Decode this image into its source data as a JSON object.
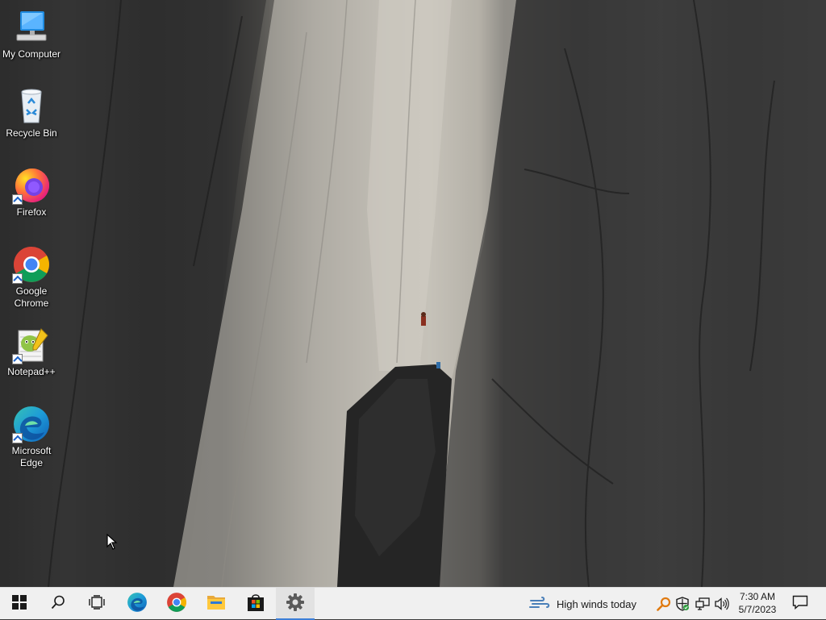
{
  "desktop": {
    "icons": [
      {
        "label": "My Computer",
        "icon": "computer-icon",
        "shortcut": false
      },
      {
        "label": "Recycle Bin",
        "icon": "recycle-bin-icon",
        "shortcut": false
      },
      {
        "label": "Firefox",
        "icon": "firefox-icon",
        "shortcut": true
      },
      {
        "label": "Google Chrome",
        "icon": "chrome-icon",
        "shortcut": true
      },
      {
        "label": "Notepad++",
        "icon": "notepadpp-icon",
        "shortcut": true
      },
      {
        "label": "Microsoft Edge",
        "icon": "edge-icon",
        "shortcut": true
      }
    ]
  },
  "taskbar": {
    "buttons": [
      {
        "name": "start-button",
        "icon": "windows-logo-icon"
      },
      {
        "name": "search-button",
        "icon": "search-icon"
      },
      {
        "name": "task-view-button",
        "icon": "task-view-icon"
      },
      {
        "name": "edge-taskbar-button",
        "icon": "edge-icon"
      },
      {
        "name": "chrome-taskbar-button",
        "icon": "chrome-icon"
      },
      {
        "name": "file-explorer-button",
        "icon": "folder-icon"
      },
      {
        "name": "store-button",
        "icon": "store-icon"
      },
      {
        "name": "settings-button",
        "icon": "gear-icon",
        "active": true
      }
    ],
    "weather": {
      "text": "High winds today",
      "icon": "wind-icon"
    },
    "tray": {
      "icons": [
        "search-tray-icon",
        "defender-icon",
        "network-icon",
        "volume-icon"
      ]
    },
    "clock": {
      "time": "7:30 AM",
      "date": "5/7/2023"
    },
    "notifications": {
      "icon": "notification-icon"
    }
  },
  "colors": {
    "taskbar_bg": "#f0f0f0",
    "accent": "#3c7fd8"
  }
}
